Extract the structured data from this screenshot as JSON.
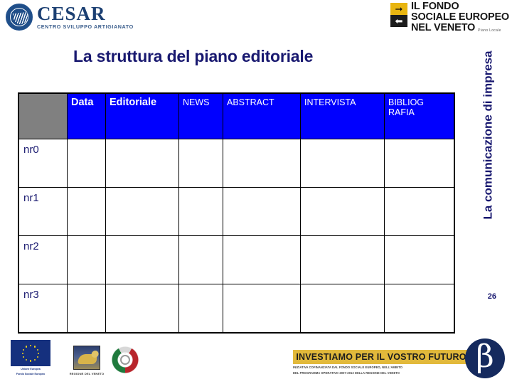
{
  "header": {
    "cesar": {
      "name": "CESAR",
      "subtitle": "CENTRO SVILUPPO ARTIGIANATO",
      "mark_icon": "cesar-circle-wave-icon"
    },
    "fse": {
      "line1": "IL FONDO",
      "line2": "SOCIALE EUROPEO",
      "line3": "NEL VENETO",
      "tagline": "Piano Locale",
      "arrow_right_icon": "arrow-right-icon",
      "arrow_left_icon": "arrow-left-icon"
    }
  },
  "title": "La struttura del piano editoriale",
  "side_banner": {
    "text": "La comunicazione di impresa"
  },
  "page_number": "26",
  "table": {
    "corner_label": "",
    "columns": [
      {
        "label": "Data",
        "emphasis": "bold"
      },
      {
        "label": "Editoriale",
        "emphasis": "bold"
      },
      {
        "label": "NEWS",
        "emphasis": "normal"
      },
      {
        "label": "ABSTRACT",
        "emphasis": "normal"
      },
      {
        "label": "INTERVISTA",
        "emphasis": "normal"
      },
      {
        "label": "BIBLIOG RAFIA",
        "emphasis": "normal"
      }
    ],
    "rows": [
      {
        "label": "nr0",
        "cells": [
          "",
          "",
          "",
          "",
          "",
          ""
        ]
      },
      {
        "label": "nr1",
        "cells": [
          "",
          "",
          "",
          "",
          "",
          ""
        ]
      },
      {
        "label": "nr2",
        "cells": [
          "",
          "",
          "",
          "",
          "",
          ""
        ]
      },
      {
        "label": "nr3",
        "cells": [
          "",
          "",
          "",
          "",
          "",
          ""
        ]
      }
    ],
    "colors": {
      "header_fill": "#0000FF",
      "header_text": "#FFFFFF",
      "corner_fill": "#808080",
      "body_fill": "#FFFFFF",
      "border": "#000000",
      "row_label_text": "#191970"
    }
  },
  "footer": {
    "eu": {
      "caption_line1": "Unione Europea",
      "caption_line2": "Fondo Sociale Europeo",
      "flag_icon": "eu-flag-icon"
    },
    "veneto": {
      "caption": "REGIONE DEL VENETO",
      "emblem_icon": "veneto-lion-icon"
    },
    "italia": {
      "emblem_icon": "repubblica-italiana-emblem-icon"
    },
    "investimento": {
      "headline": "INVESTIAMO PER IL VOSTRO FUTURO",
      "subline1": "INIZIATIVA COFINANZIATA DAL FONDO SOCIALE EUROPEO, NELL'AMBITO",
      "subline2": "DEL PROGRAMMA OPERATIVO 2007-2013 DELLA REGIONE DEL VENETO"
    },
    "beta": {
      "glyph": "β",
      "icon": "beta-circle-logo-icon"
    }
  },
  "theme": {
    "title_color": "#191970",
    "accent_blue": "#0000FF",
    "gold": "#E2B93B",
    "navy": "#152A5E"
  }
}
